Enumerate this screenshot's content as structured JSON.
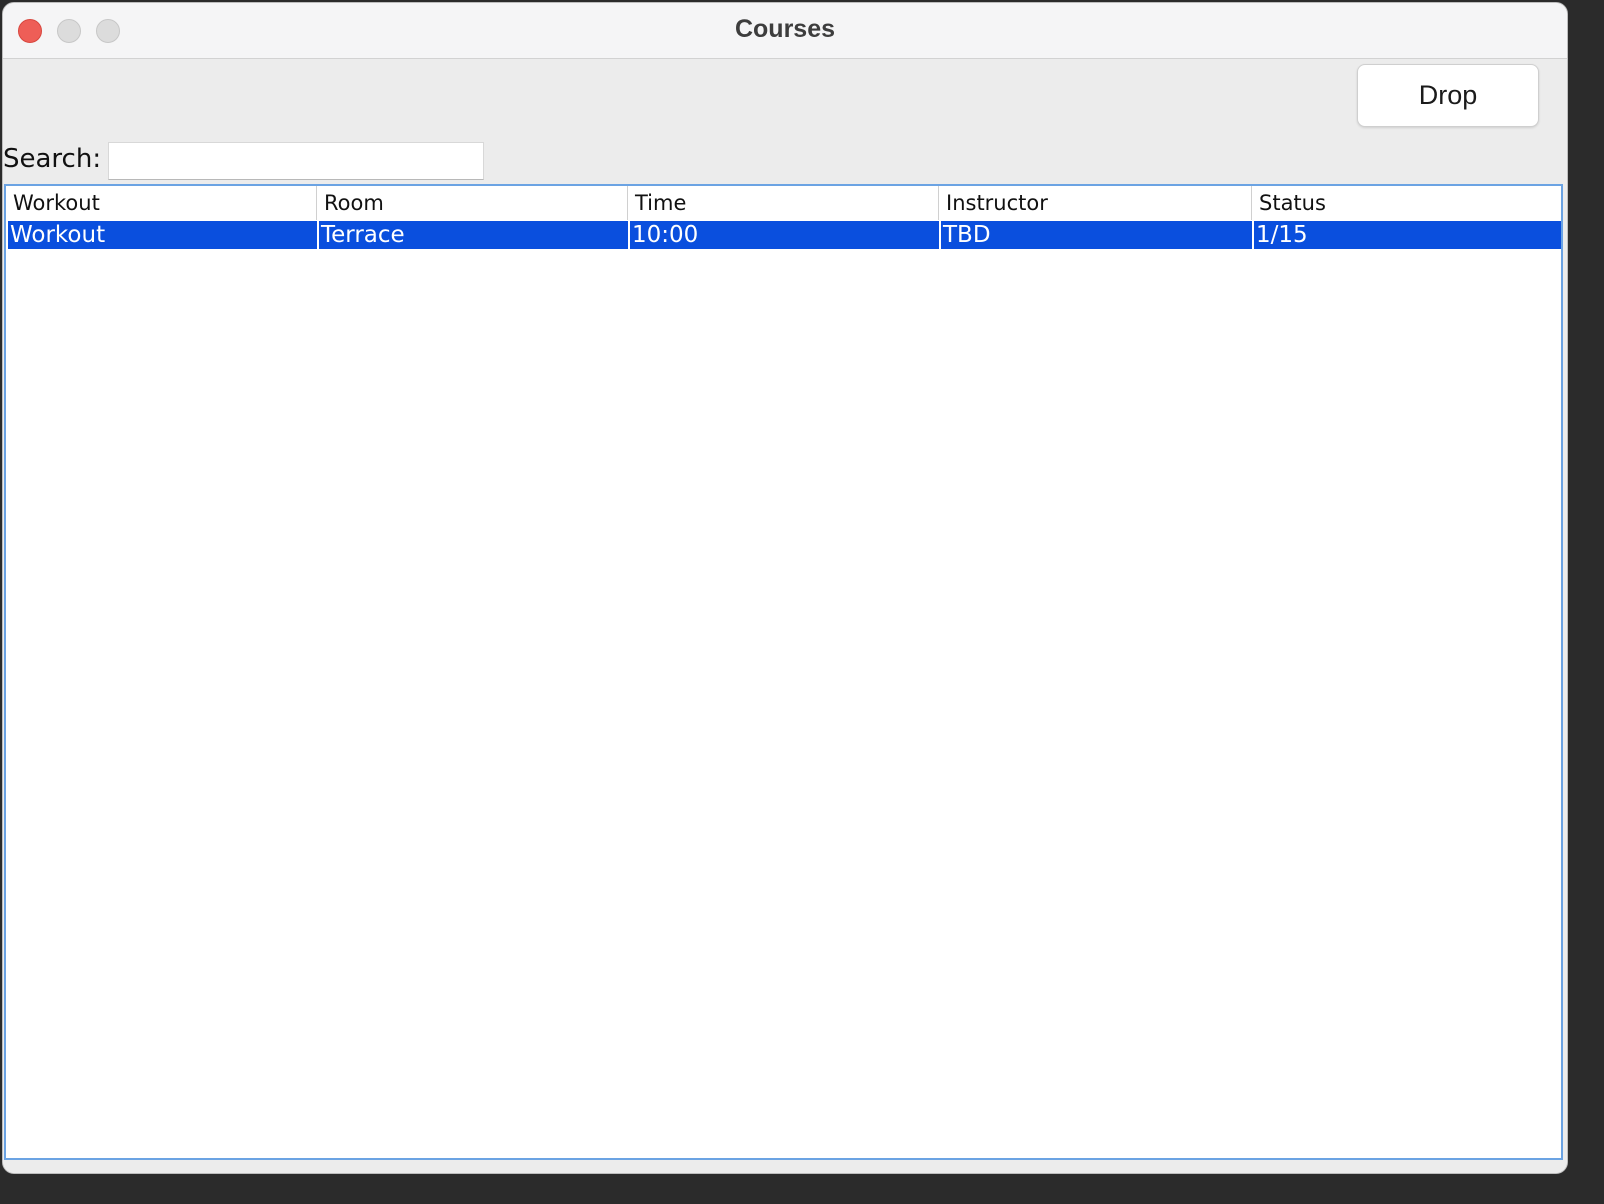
{
  "window": {
    "title": "Courses"
  },
  "toolbar": {
    "drop_label": "Drop"
  },
  "search": {
    "label": "Search:",
    "value": "",
    "placeholder": ""
  },
  "table": {
    "columns": [
      "Workout",
      "Room",
      "Time",
      "Instructor",
      "Status"
    ],
    "rows": [
      [
        "Workout",
        "Terrace",
        "10:00",
        "TBD",
        "1/15"
      ]
    ],
    "selected_row": 0
  },
  "colors": {
    "selection": "#0a4fde",
    "close_button": "#ee5e57",
    "table_border": "#6ba3e3"
  }
}
